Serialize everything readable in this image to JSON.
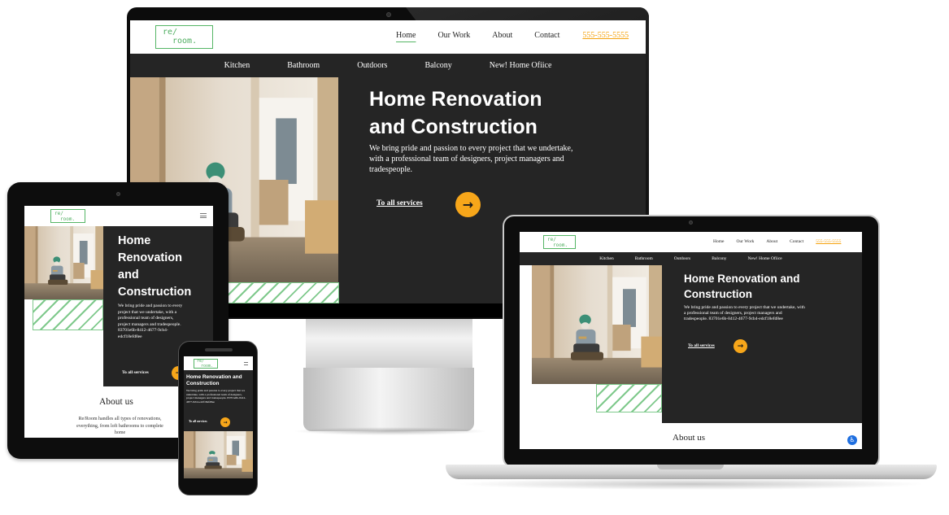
{
  "brand": {
    "logo_top": "re/",
    "logo_bottom": "room.",
    "logo_short": "re/room."
  },
  "nav": {
    "home": "Home",
    "our_work": "Our Work",
    "about": "About",
    "contact": "Contact",
    "phone": "555-555-5555"
  },
  "categories": [
    "Kitchen",
    "Bathroom",
    "Outdoors",
    "Balcony",
    "New! Home Ofiice"
  ],
  "hero": {
    "title_line1": "Home Renovation",
    "title_line2": "and Construction",
    "title_full": "Home Renovation and Construction",
    "tablet_title_1": "Home",
    "tablet_title_2": "Renovation",
    "tablet_title_3": "and",
    "tablet_title_4": "Construction",
    "text": "We bring pride and passion to every project that we undertake, with a professional team of designers, project managers and tradespeople.",
    "text_with_id": "We bring pride and passion to every project that we undertake, with a professional team of designers, project managers and tradespeople. 83701e6b-8412-4677-9cb4-edcf18efd8ee",
    "cta": "To all services",
    "arrow_icon": "→"
  },
  "about": {
    "heading": "About us",
    "text": "Re/Room handles all types of renovations, everything, from loft bathrooms to complete home"
  },
  "colors": {
    "accent": "#f7a61a",
    "dark": "#252525",
    "green": "#55b565",
    "phone": "#f5a30f"
  }
}
